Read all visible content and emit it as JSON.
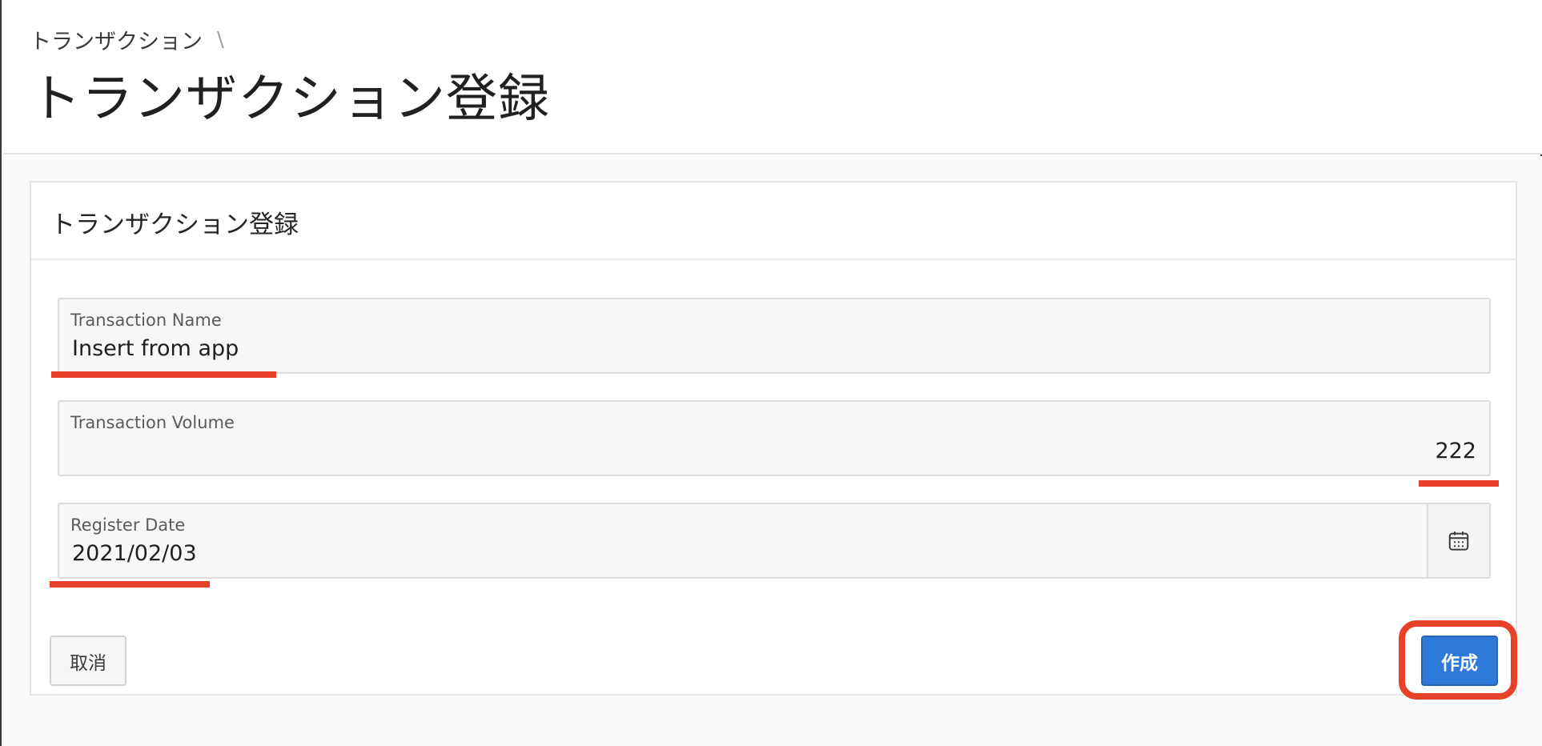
{
  "breadcrumb": {
    "items": [
      "トランザクション"
    ],
    "separator": "\\"
  },
  "page": {
    "title": "トランザクション登録"
  },
  "region": {
    "title": "トランザクション登録"
  },
  "form": {
    "transaction_name": {
      "label": "Transaction Name",
      "value": "Insert from app"
    },
    "transaction_volume": {
      "label": "Transaction Volume",
      "value": "222"
    },
    "register_date": {
      "label": "Register Date",
      "value": "2021/02/03",
      "icon": "calendar-icon"
    }
  },
  "buttons": {
    "cancel_label": "取消",
    "create_label": "作成"
  },
  "colors": {
    "primary": "#2f7ad8",
    "annotation": "#e8412a"
  }
}
